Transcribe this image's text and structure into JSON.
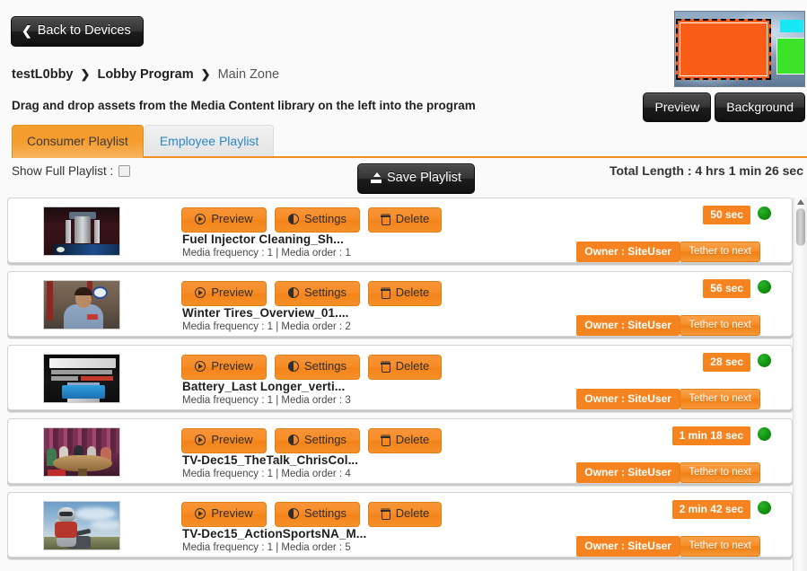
{
  "header": {
    "back_button": "Back to Devices",
    "breadcrumb": {
      "device": "testL0bby",
      "program": "Lobby Program",
      "zone": "Main Zone",
      "separator": "❯"
    },
    "instructions": "Drag and drop assets from the Media Content library on the left into the program"
  },
  "preview_panel": {
    "preview_button": "Preview",
    "background_button": "Background",
    "zones": [
      {
        "name": "main-zone",
        "color": "#f95d17",
        "selected": true
      },
      {
        "name": "top-right-zone",
        "color": "#18e8f5",
        "selected": false
      },
      {
        "name": "bottom-right-zone",
        "color": "#3ce429",
        "selected": false
      }
    ]
  },
  "tabs": [
    {
      "label": "Consumer Playlist",
      "active": true
    },
    {
      "label": "Employee Playlist",
      "active": false
    }
  ],
  "controls": {
    "show_full_playlist_label": "Show Full Playlist :",
    "show_full_playlist_checked": false,
    "save_playlist_label": "Save Playlist",
    "total_length_label": "Total Length : 4 hrs 1 min 26 sec"
  },
  "row_buttons": {
    "preview": "Preview",
    "settings": "Settings",
    "delete": "Delete",
    "tether": "Tether to next"
  },
  "accent_colors": {
    "orange": "#f5831f",
    "tab_orange": "#f0911f",
    "status_green": "#0a8a0a",
    "dark_button": "#333333"
  },
  "playlist": [
    {
      "title": "Fuel Injector Cleaning_Sh...",
      "meta": "Media frequency : 1 | Media order : 1",
      "duration": "50 sec",
      "owner": "Owner : SiteUser",
      "status": "active",
      "thumb": "fuel-injector-thumbnail"
    },
    {
      "title": "Winter Tires_Overview_01....",
      "meta": "Media frequency : 1 | Media order : 2",
      "duration": "56 sec",
      "owner": "Owner : SiteUser",
      "status": "active",
      "thumb": "winter-tires-thumbnail"
    },
    {
      "title": "Battery_Last Longer_verti...",
      "meta": "Media frequency : 1 | Media order : 3",
      "duration": "28 sec",
      "owner": "Owner : SiteUser",
      "status": "active",
      "thumb": "battery-thumbnail"
    },
    {
      "title": "TV-Dec15_TheTalk_ChrisCol...",
      "meta": "Media frequency : 1 | Media order : 4",
      "duration": "1 min 18 sec",
      "owner": "Owner : SiteUser",
      "status": "active",
      "thumb": "the-talk-thumbnail"
    },
    {
      "title": "TV-Dec15_ActionSportsNA_M...",
      "meta": "Media frequency : 1 | Media order : 5",
      "duration": "2 min 42 sec",
      "owner": "Owner : SiteUser",
      "status": "active",
      "thumb": "action-sports-thumbnail"
    }
  ]
}
